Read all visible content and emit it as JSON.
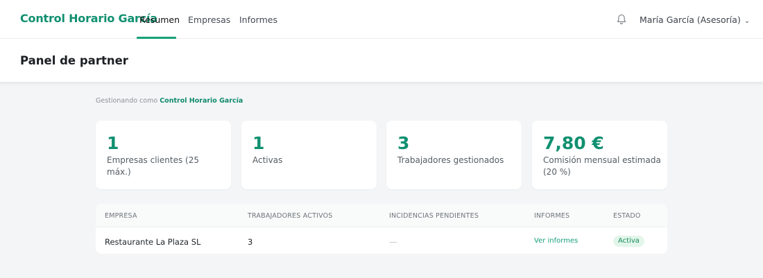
{
  "header": {
    "brand": "Control Horario García",
    "tabs": [
      {
        "label": "Resumen",
        "active": true
      },
      {
        "label": "Empresas",
        "active": false
      },
      {
        "label": "Informes",
        "active": false
      }
    ],
    "user": "María García (Asesoría)",
    "icons": {
      "notifications": "bell-icon",
      "user_menu": "chevron-down-icon"
    }
  },
  "page": {
    "title": "Panel de partner",
    "managing_prefix": "Gestionando como",
    "managing_company": "Control Horario García"
  },
  "stats": [
    {
      "value": "1",
      "label": "Empresas clientes (25 máx.)"
    },
    {
      "value": "1",
      "label": "Activas"
    },
    {
      "value": "3",
      "label": "Trabajadores gestionados"
    },
    {
      "value": "7,80 €",
      "label": "Comisión mensual estimada (20 %)"
    }
  ],
  "table": {
    "columns": [
      "EMPRESA",
      "TRABAJADORES ACTIVOS",
      "INCIDENCIAS PENDIENTES",
      "INFORMES",
      "ESTADO"
    ],
    "rows": [
      {
        "empresa": "Restaurante La Plaza SL",
        "trabajadores": "3",
        "incidencias": "—",
        "informes": "Ver informes",
        "estado": "Activa"
      }
    ]
  },
  "colors": {
    "accent": "#109070",
    "background": "#f4f5f6",
    "badge_bg": "#e2f6ea"
  }
}
